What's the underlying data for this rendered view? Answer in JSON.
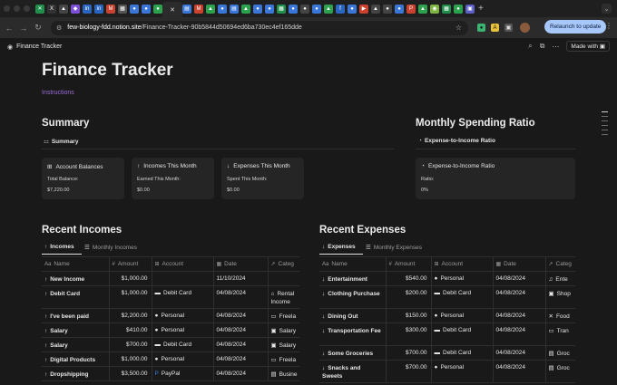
{
  "browser": {
    "tab_icons": [
      {
        "name": "excel-tab-icon",
        "color": "#1f8f4b",
        "glyph": "✕"
      },
      {
        "name": "x-tab-icon",
        "color": "#333333",
        "glyph": "X"
      },
      {
        "name": "a-tab-icon",
        "color": "#444444",
        "glyph": "▲"
      },
      {
        "name": "purple-tab-icon",
        "color": "#7b4fd6",
        "glyph": "◆"
      },
      {
        "name": "linkedin-tab-icon",
        "color": "#2a66c0",
        "glyph": "in"
      },
      {
        "name": "linkedin-tab-icon-2",
        "color": "#2a66c0",
        "glyph": "in"
      },
      {
        "name": "gmail-tab-icon",
        "color": "#c9412f",
        "glyph": "M"
      },
      {
        "name": "grid-tab-icon",
        "color": "#555555",
        "glyph": "▦"
      },
      {
        "name": "chrome-tab-icon",
        "color": "#3a76d8",
        "glyph": "●"
      },
      {
        "name": "chrome-tab-icon-2",
        "color": "#3a76d8",
        "glyph": "●"
      },
      {
        "name": "whatsapp-tab-icon",
        "color": "#2ca24e",
        "glyph": "●"
      }
    ],
    "active_tab_glyph": "✕",
    "tab_icons_right": [
      {
        "name": "docs-tab-icon",
        "color": "#3a76d8",
        "glyph": "▤"
      },
      {
        "name": "gmail-tab-icon-2",
        "color": "#c9412f",
        "glyph": "M"
      },
      {
        "name": "drive-tab-icon",
        "color": "#2ca24e",
        "glyph": "▲"
      },
      {
        "name": "chrome-tab-icon-3",
        "color": "#3a76d8",
        "glyph": "●"
      },
      {
        "name": "docs-tab-icon-2",
        "color": "#3a76d8",
        "glyph": "▤"
      },
      {
        "name": "drive-tab-icon-2",
        "color": "#2ca24e",
        "glyph": "▲"
      },
      {
        "name": "chrome-tab-icon-4",
        "color": "#3a76d8",
        "glyph": "●"
      },
      {
        "name": "chrome-tab-icon-5",
        "color": "#3a76d8",
        "glyph": "●"
      },
      {
        "name": "sheets-tab-icon",
        "color": "#1f8f4b",
        "glyph": "▦"
      },
      {
        "name": "chrome-tab-icon-6",
        "color": "#3a76d8",
        "glyph": "●"
      },
      {
        "name": "github-tab-icon",
        "color": "#444444",
        "glyph": "●"
      },
      {
        "name": "chrome-tab-icon-7",
        "color": "#3a76d8",
        "glyph": "●"
      },
      {
        "name": "drive-tab-icon-3",
        "color": "#2ca24e",
        "glyph": "▲"
      },
      {
        "name": "facebook-tab-icon",
        "color": "#2a66c0",
        "glyph": "f"
      },
      {
        "name": "chrome-tab-icon-8",
        "color": "#3a76d8",
        "glyph": "●"
      },
      {
        "name": "youtube-tab-icon",
        "color": "#c9412f",
        "glyph": "▶"
      },
      {
        "name": "vercel-tab-icon",
        "color": "#444444",
        "glyph": "▲"
      },
      {
        "name": "github-tab-icon-2",
        "color": "#444444",
        "glyph": "●"
      },
      {
        "name": "chrome-tab-icon-9",
        "color": "#3a76d8",
        "glyph": "●"
      },
      {
        "name": "pinterest-tab-icon",
        "color": "#c9412f",
        "glyph": "P"
      },
      {
        "name": "drive-tab-icon-4",
        "color": "#2ca24e",
        "glyph": "▲"
      },
      {
        "name": "android-tab-icon",
        "color": "#7cb342",
        "glyph": "◉"
      },
      {
        "name": "sheets-tab-icon-2",
        "color": "#1f8f4b",
        "glyph": "▦"
      },
      {
        "name": "spotify-tab-icon",
        "color": "#2ca24e",
        "glyph": "●"
      },
      {
        "name": "teams-tab-icon",
        "color": "#5b5fc7",
        "glyph": "▣"
      }
    ],
    "new_tab_glyph": "+",
    "tab_menu_glyph": "⌄",
    "back_glyph": "←",
    "forward_glyph": "→",
    "reload_glyph": "↻",
    "url_host": "few-biology-fdd.notion.site",
    "url_path": "/Finance-Tracker-90b5844d50694ed6ba730ec4ef165dde",
    "relaunch_label": "Relaunch to update",
    "relaunch_more": "⋮"
  },
  "notion_topbar": {
    "breadcrumb": "Finance Tracker",
    "made_with_label": "Made with"
  },
  "page": {
    "title": "Finance Tracker",
    "instructions_link": "Instructions"
  },
  "summary": {
    "heading": "Summary",
    "view_label": "Summary",
    "cards": [
      {
        "title": "Account Balances",
        "icon": "⊞",
        "label": "Total Balance:",
        "value": "$7,220.00"
      },
      {
        "title": "Incomes This Month",
        "icon": "↑",
        "label": "Earned This Month:",
        "value": "$0.00"
      },
      {
        "title": "Expenses This Month",
        "icon": "↓",
        "label": "Spent This Month:",
        "value": "$0.00"
      }
    ]
  },
  "ratio": {
    "heading": "Monthly Spending Ratio",
    "view_label": "Expense-to-Income Ratio",
    "card_title": "Expense-to-Income Ratio",
    "card_label": "Ratio:",
    "card_value": "0%"
  },
  "incomes": {
    "heading": "Recent Incomes",
    "tab_active": "Incomes",
    "tab_other": "Monthly Incomes",
    "columns": {
      "name": "Name",
      "amount": "Amount",
      "account": "Account",
      "date": "Date",
      "category": "Categ"
    },
    "rows": [
      {
        "name": "New Income",
        "amount": "$1,000.00",
        "account": "",
        "account_icon": "",
        "date": "11/10/2024",
        "category": "",
        "cat_icon": ""
      },
      {
        "name": "Debit Card",
        "amount": "$1,000.00",
        "account": "Debit Card",
        "account_icon": "▬",
        "date": "04/08/2024",
        "category": "Rental Income",
        "cat_icon": "⌂"
      },
      {
        "name": "I've been paid",
        "amount": "$2,200.00",
        "account": "Personal",
        "account_icon": "●",
        "date": "04/08/2024",
        "category": "Freela",
        "cat_icon": "▭"
      },
      {
        "name": "Salary",
        "amount": "$410.00",
        "account": "Personal",
        "account_icon": "●",
        "date": "04/08/2024",
        "category": "Salary",
        "cat_icon": "▣"
      },
      {
        "name": "Salary",
        "amount": "$700.00",
        "account": "Debit Card",
        "account_icon": "▬",
        "date": "04/08/2024",
        "category": "Salary",
        "cat_icon": "▣"
      },
      {
        "name": "Digital Products",
        "amount": "$1,000.00",
        "account": "Personal",
        "account_icon": "●",
        "date": "04/08/2024",
        "category": "Freela",
        "cat_icon": "▭"
      },
      {
        "name": "Dropshipping",
        "amount": "$3,500.00",
        "account": "PayPal",
        "account_icon": "P",
        "date": "04/08/2024",
        "category": "Busine",
        "cat_icon": "▤"
      }
    ]
  },
  "expenses": {
    "heading": "Recent Expenses",
    "tab_active": "Expenses",
    "tab_other": "Monthly Expenses",
    "columns": {
      "name": "Name",
      "amount": "Amount",
      "account": "Account",
      "date": "Date",
      "category": "Categ"
    },
    "rows": [
      {
        "name": "Entertainment",
        "amount": "$540.00",
        "account": "Personal",
        "account_icon": "●",
        "date": "04/08/2024",
        "category": "Ente",
        "cat_icon": "♫"
      },
      {
        "name": "Clothing Purchase",
        "amount": "$200.00",
        "account": "Debit Card",
        "account_icon": "▬",
        "date": "04/08/2024",
        "category": "Shop",
        "cat_icon": "▣"
      },
      {
        "name": "Dining Out",
        "amount": "$150.00",
        "account": "Personal",
        "account_icon": "●",
        "date": "04/08/2024",
        "category": "Food",
        "cat_icon": "✕"
      },
      {
        "name": "Transportation Fee",
        "amount": "$300.00",
        "account": "Debit Card",
        "account_icon": "▬",
        "date": "04/08/2024",
        "category": "Tran",
        "cat_icon": "▭"
      },
      {
        "name": "Some Groceries",
        "amount": "$700.00",
        "account": "Debit Card",
        "account_icon": "▬",
        "date": "04/08/2024",
        "category": "Groc",
        "cat_icon": "▤"
      },
      {
        "name": "Snacks and Sweets",
        "amount": "$700.00",
        "account": "Personal",
        "account_icon": "●",
        "date": "04/08/2024",
        "category": "Groc",
        "cat_icon": "▤"
      }
    ]
  }
}
